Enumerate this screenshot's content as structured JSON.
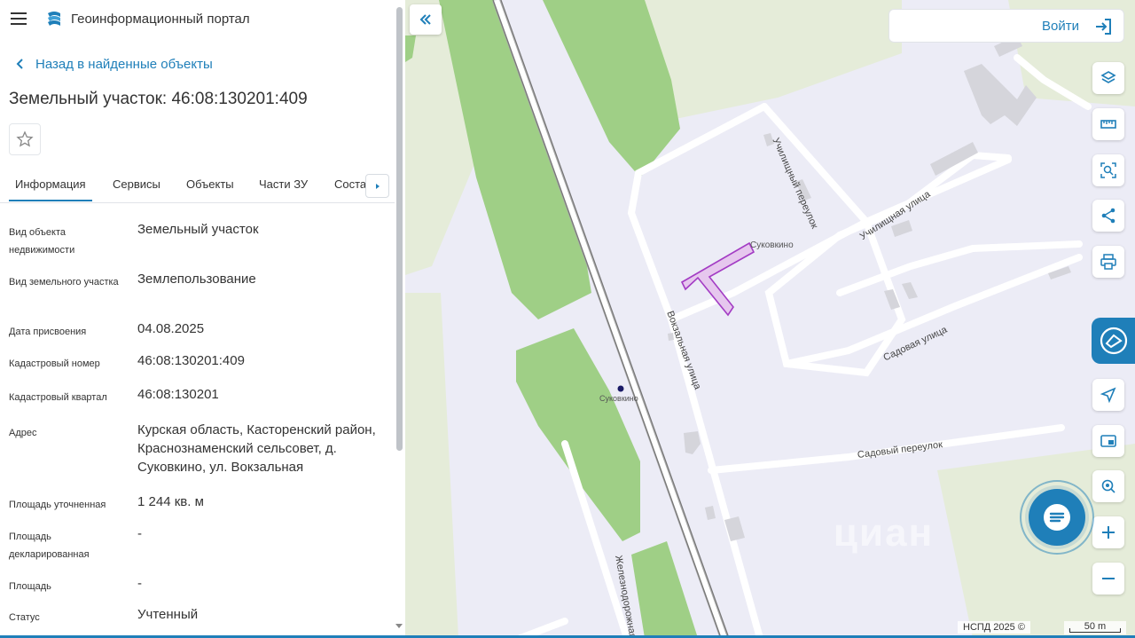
{
  "app": {
    "title": "Геоинформационный портал"
  },
  "nav": {
    "back_label": "Назад в найденные объекты"
  },
  "object": {
    "title": "Земельный участок: 46:08:130201:409"
  },
  "tabs": [
    {
      "label": "Информация"
    },
    {
      "label": "Сервисы"
    },
    {
      "label": "Объекты"
    },
    {
      "label": "Части ЗУ"
    },
    {
      "label": "Соста"
    }
  ],
  "properties": [
    {
      "label": "Вид объекта недвижимости",
      "value": "Земельный участок"
    },
    {
      "label": "Вид земельного участка",
      "value": "Землепользование"
    },
    {
      "label": "Дата присвоения",
      "value": "04.08.2025"
    },
    {
      "label": "Кадастровый номер",
      "value": "46:08:130201:409"
    },
    {
      "label": "Кадастровый квартал",
      "value": "46:08:130201"
    },
    {
      "label": "Адрес",
      "value": "Курская область, Касторенский район, Краснознаменский сельсовет, д. Суковкино, ул. Вокзальная"
    },
    {
      "label": "Площадь уточненная",
      "value": "1 244 кв. м"
    },
    {
      "label": "Площадь декларированная",
      "value": "-"
    },
    {
      "label": "Площадь",
      "value": "-"
    },
    {
      "label": "Статус",
      "value": "Учтенный"
    }
  ],
  "header": {
    "login_label": "Войти"
  },
  "map": {
    "labels": {
      "village_top": "Суковкино",
      "village_station": "Суковкино",
      "street_school_lane": "Училищный переулок",
      "street_school": "Училищная улица",
      "street_station": "Вокзальная улица",
      "street_garden": "Садовая улица",
      "street_garden_lane": "Садовый переулок",
      "street_rail": "Железнодорожная"
    },
    "attribution": "НСПД 2025 ©",
    "scale_label": "50 m",
    "watermark": "циан"
  },
  "colors": {
    "accent": "#1f7fb9",
    "parcel_fill": "#e6c7ee",
    "parcel_stroke": "#a33cc4",
    "forest": "#9fcf86",
    "background_land": "#ececf6",
    "field": "#e5ecd9"
  }
}
